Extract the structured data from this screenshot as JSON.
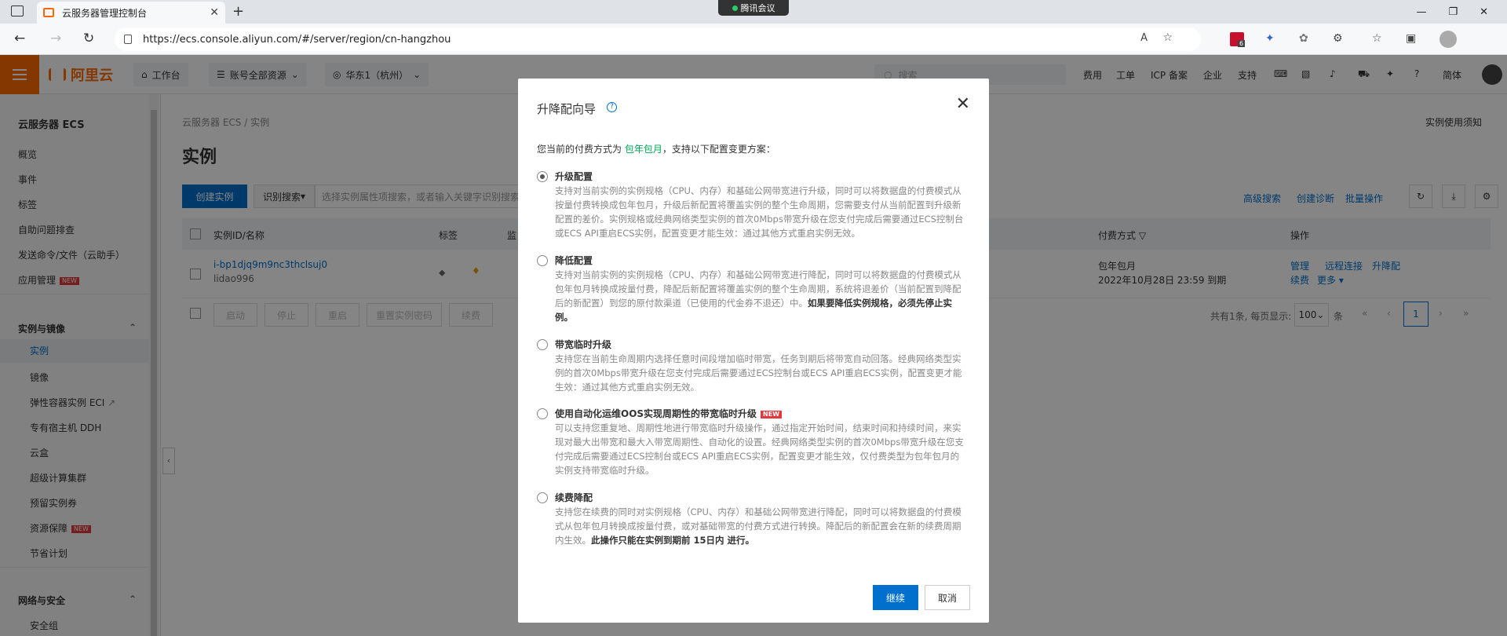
{
  "browser": {
    "tab_title": "云服务器管理控制台",
    "meeting_label": "腾讯会议",
    "url": "https://ecs.console.aliyun.com/#/server/region/cn-hangzhou",
    "ext_badge": "6"
  },
  "topbar": {
    "logo": "阿里云",
    "workbench": "工作台",
    "resources": "账号全部资源",
    "region": "华东1（杭州）",
    "search_placeholder": "搜索",
    "links": [
      "费用",
      "工单",
      "ICP 备案",
      "企业",
      "支持"
    ],
    "lang": "简体"
  },
  "sidebar": {
    "title": "云服务器 ECS",
    "items": [
      "概览",
      "事件",
      "标签",
      "自助问题排查",
      "发送命令/文件（云助手）",
      "应用管理"
    ],
    "group1": "实例与镜像",
    "group1_items": [
      "实例",
      "镜像",
      "弹性容器实例 ECI",
      "专有宿主机 DDH",
      "云盒",
      "超级计算集群",
      "预留实例券",
      "资源保障",
      "节省计划"
    ],
    "group2": "网络与安全",
    "group2_items": [
      "安全组"
    ],
    "new_badge": "NEW"
  },
  "main": {
    "breadcrumb": "云服务器 ECS / 实例",
    "title": "实例",
    "usage_note": "实例使用须知",
    "create_button": "创建实例",
    "filter_label": "识别搜索",
    "filter_placeholder": "选择实例属性项搜索，或者输入关键字识别搜索",
    "actions": [
      "高级搜索",
      "创建诊断",
      "批量操作"
    ],
    "headers": [
      "实例ID/名称",
      "标签",
      "监",
      "付费方式",
      "操作"
    ],
    "row": {
      "id": "i-bp1djq9m9nc3thclsuj0",
      "name": "lidao996",
      "billing": "包年包月",
      "expire": "2022年10月28日 23:59 到期",
      "ops": [
        "管理",
        "远程连接",
        "升降配",
        "续费",
        "更多"
      ]
    },
    "bulk_buttons": [
      "启动",
      "停止",
      "重启",
      "重置实例密码",
      "续费"
    ],
    "pagination": {
      "summary": "共有1条, 每页显示:",
      "page_size": "100",
      "unit": "条",
      "current": "1"
    }
  },
  "modal": {
    "title": "升降配向导",
    "help": "?",
    "intro_prefix": "您当前的付费方式为",
    "intro_highlight": "包年包月",
    "intro_suffix": "，支持以下配置变更方案：",
    "options": [
      {
        "title": "升级配置",
        "desc": "支持对当前实例的实例规格（CPU、内存）和基础公网带宽进行升级，同时可以将数据盘的付费模式从按量付费转换成包年包月，升级后新配置将覆盖实例的整个生命周期，您需要支付从当前配置到升级新配置的差价。实例规格或经典网络类型实例的首次0Mbps带宽升级在您支付完成后需要通过ECS控制台或ECS API重启ECS实例，配置变更才能生效：通过其他方式重启实例无效。",
        "bold": ""
      },
      {
        "title": "降低配置",
        "desc": "支持对当前实例的实例规格（CPU、内存）和基础公网带宽进行降配，同时可以将数据盘的付费模式从包年包月转换成按量付费，降配后新配置将覆盖实例的整个生命周期，系统将退差价（当前配置到降配后的新配置）到您的原付款渠道（已使用的代金券不退还）中。",
        "bold": "如果要降低实例规格，必须先停止实例。"
      },
      {
        "title": "带宽临时升级",
        "desc": "支持您在当前生命周期内选择任意时间段增加临时带宽，任务到期后将带宽自动回落。经典网络类型实例的首次0Mbps带宽升级在您支付完成后需要通过ECS控制台或ECS API重启ECS实例，配置变更才能生效：通过其他方式重启实例无效。",
        "bold": ""
      },
      {
        "title": "使用自动化运维OOS实现周期性的带宽临时升级",
        "desc": "可以支持您重复地、周期性地进行带宽临时升级操作，通过指定开始时间，结束时间和持续时间，来实现对最大出带宽和最大入带宽周期性、自动化的设置。经典网络类型实例的首次0Mbps带宽升级在您支付完成后需要通过ECS控制台或ECS API重启ECS实例，配置变更才能生效，仅付费类型为包年包月的实例支持带宽临时升级。",
        "bold": "",
        "badge": "NEW"
      },
      {
        "title": "续费降配",
        "desc": "支持您在续费的同时对实例规格（CPU、内存）和基础公网带宽进行降配，同时可以将数据盘的付费模式从包年包月转换成按量付费，或对基础带宽的付费方式进行转换。降配后的新配置会在新的续费周期内生效。",
        "bold": "此操作只能在实例到期前 15日内 进行。"
      }
    ],
    "continue": "继续",
    "cancel": "取消"
  },
  "colors": {
    "brand": "#ff6a00",
    "primary": "#0070cc",
    "highlight": "#00a656",
    "badge": "#e3393c"
  }
}
